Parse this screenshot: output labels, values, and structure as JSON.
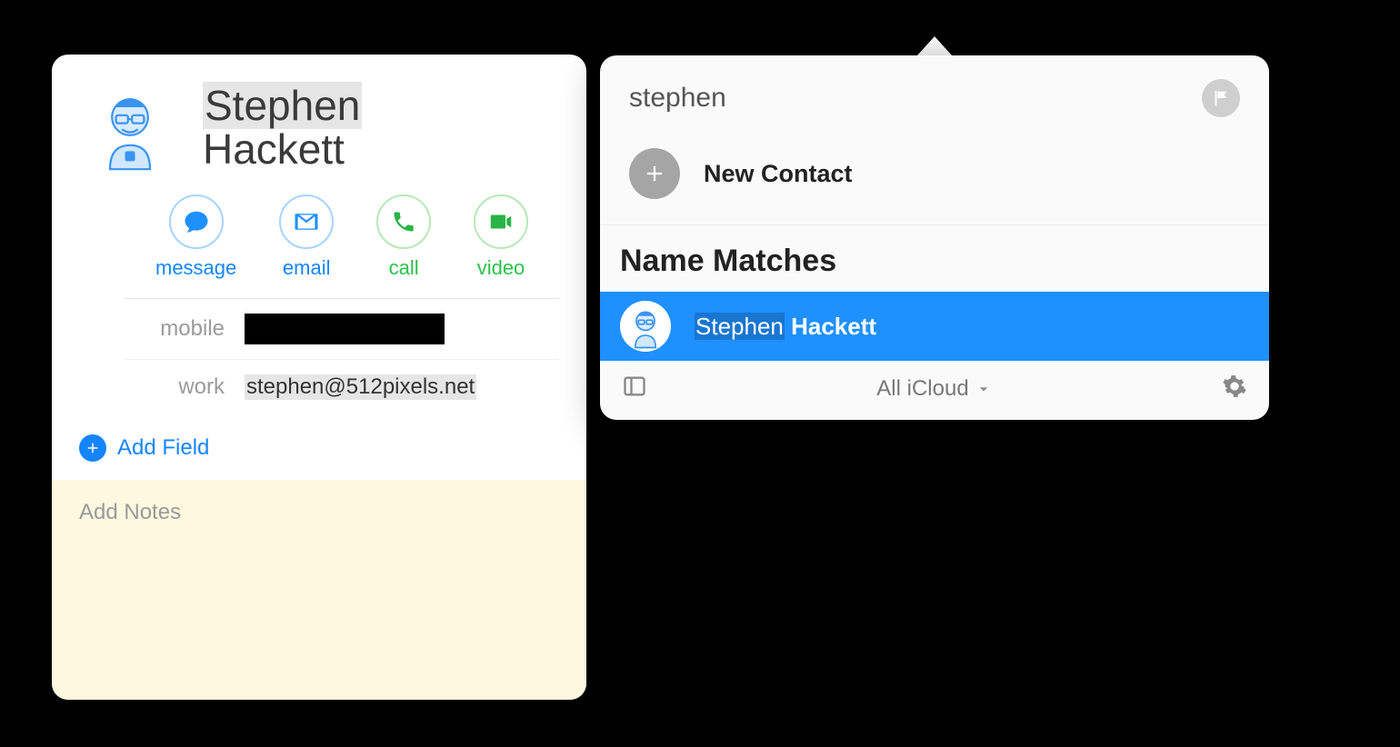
{
  "contact": {
    "first_name": "Stephen",
    "last_name": "Hackett",
    "actions": {
      "message": "message",
      "email": "email",
      "call": "call",
      "video": "video"
    },
    "fields": [
      {
        "label": "mobile",
        "value": ""
      },
      {
        "label": "work",
        "value": "stephen@512pixels.net"
      }
    ],
    "add_field_label": "Add Field",
    "notes_placeholder": "Add Notes"
  },
  "search": {
    "query": "stephen",
    "new_contact_label": "New Contact",
    "section_title": "Name Matches",
    "match": {
      "first": "Stephen",
      "last": "Hackett"
    },
    "group_label": "All iCloud"
  }
}
